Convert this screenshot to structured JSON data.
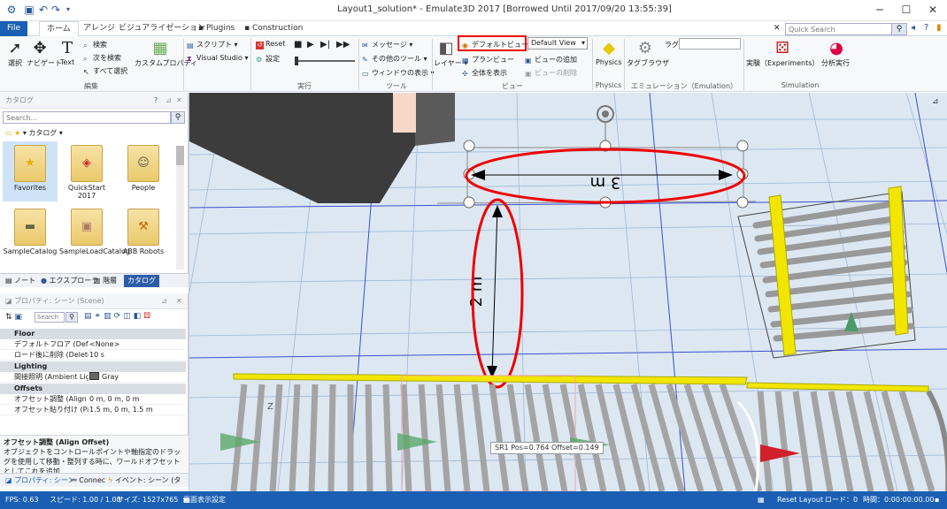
{
  "window": {
    "title": "Layout1_solution* - Emulate3D 2017 [Borrowed Until 2017/09/20 13:55:39]",
    "minimize": "─",
    "maximize": "☐",
    "close": "✕"
  },
  "tabs": [
    {
      "label": "File"
    },
    {
      "label": "ホーム"
    },
    {
      "label": "アレンジ"
    },
    {
      "label": "ビジュアライゼーション"
    },
    {
      "label": "Plugins"
    },
    {
      "label": "Construction"
    }
  ],
  "quick_search": {
    "placeholder": "Quick Search"
  },
  "ribbon": {
    "edit": {
      "label": "編集",
      "select": "選択",
      "navigate": "ナビゲート",
      "text": "Text",
      "search": "検索",
      "find_next": "次を検索",
      "select_all": "すべて選択",
      "custom_props": "カスタムプロパティ"
    },
    "script": {
      "script": "スクリプト",
      "visual_studio": "Visual Studio"
    },
    "run": {
      "label": "実行",
      "reset": "Reset",
      "settings": "設定"
    },
    "tools": {
      "label": "ツール",
      "message": "メッセージ",
      "other_tools": "その他のツール",
      "window_display": "ウィンドウの表示"
    },
    "view": {
      "label": "ビュー",
      "layer": "レイヤー",
      "default_view": "デフォルトビュー",
      "plan_view": "プランビュー",
      "show_all": "全体を表示",
      "add_view": "ビューの追加",
      "delete_view": "ビューの削除",
      "view_select": "Default View"
    },
    "physics": {
      "label": "Physics",
      "physics": "Physics"
    },
    "emulation": {
      "label": "エミュレーション（Emulation）",
      "tag_browser": "タグブラウザ",
      "tag": "ラグ"
    },
    "simulation": {
      "label": "Simulation",
      "experiments": "実験（Experiments）",
      "analysis": "分析実行"
    }
  },
  "catalog": {
    "title": "カタログ",
    "search_placeholder": "Search...",
    "breadcrumb": "カタログ",
    "items": [
      {
        "label": "Favorites"
      },
      {
        "label": "QuickStart 2017"
      },
      {
        "label": "People"
      },
      {
        "label": "SampleCatalog"
      },
      {
        "label": "SampleLoadCatalog"
      },
      {
        "label": "ABB Robots"
      }
    ],
    "panel_tabs": [
      {
        "label": "ノート"
      },
      {
        "label": "エクスプローラ"
      },
      {
        "label": "階層"
      },
      {
        "label": "カタログ"
      }
    ]
  },
  "properties": {
    "title": "プロパティ: シーン (Scene)",
    "search_placeholder": "Search",
    "sections": [
      {
        "name": "Floor",
        "rows": [
          {
            "key": "デフォルトフロア (Default",
            "value": "<None>"
          },
          {
            "key": "ロード後に削除 (Delete",
            "value": "10 s"
          }
        ]
      },
      {
        "name": "Lighting",
        "rows": [
          {
            "key": "間接照明 (Ambient Lig",
            "value": "Gray"
          }
        ]
      },
      {
        "name": "Offsets",
        "rows": [
          {
            "key": "オフセット調整 (Align O",
            "value": "0 m, 0 m, 0 m"
          },
          {
            "key": "オフセット貼り付け (Paste",
            "value": "1.5 m, 0 m, 1.5 m"
          }
        ]
      }
    ],
    "desc_title": "オフセット調整 (Align Offset)",
    "desc_text": "オブジェクトをコントロールポイントや軸指定のドラッグを使用して移動・整列する時に、ワールドオフセットとしてこれを追加...",
    "bottom_tabs": [
      {
        "label": "プロパティ: シーン"
      },
      {
        "label": "Connec"
      },
      {
        "label": "イベント: シーン (タ"
      }
    ]
  },
  "viewport": {
    "dim_width": "3 m",
    "dim_height": "2 m",
    "tooltip": "SR1 Pos=0.764 Offset=0.149"
  },
  "status": {
    "fps": "FPS: 0.63",
    "speed": "スピード: 1.00 / 1.00",
    "size": "サイズ: 1527x765",
    "display_settings": "画面表示設定",
    "reset_layout": "Reset Layout",
    "load": "ロード：0",
    "time": "時間：0:00:00:00.00"
  },
  "colors": {
    "accent": "#1a5fb4",
    "highlight": "#e00000",
    "roller_frame": "#f2e600"
  }
}
